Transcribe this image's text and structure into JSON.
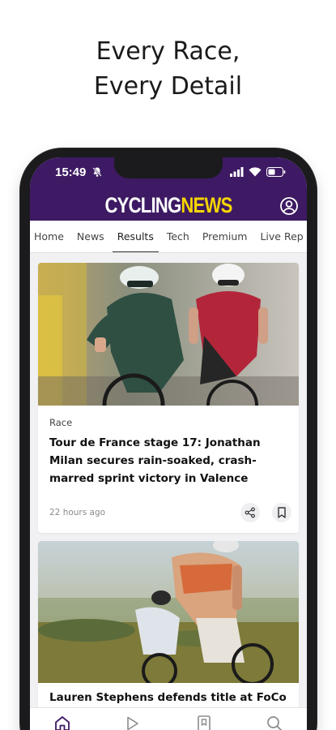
{
  "promo": {
    "line1": "Every Race,",
    "line2": "Every Detail"
  },
  "status_bar": {
    "time": "15:49"
  },
  "app": {
    "logo_part1": "CYCLING",
    "logo_part2": "NEWS"
  },
  "tabs": [
    {
      "label": "Home"
    },
    {
      "label": "News"
    },
    {
      "label": "Results",
      "active": true
    },
    {
      "label": "Tech"
    },
    {
      "label": "Premium"
    },
    {
      "label": "Live Rep"
    }
  ],
  "articles": [
    {
      "category": "Race",
      "title": "Tour de France stage 17: Jonathan Milan secures rain-soaked, crash-marred sprint victory in Valence",
      "time_ago": "22 hours ago"
    },
    {
      "title": "Lauren Stephens defends title at FoCo Fondo"
    }
  ],
  "bottom_nav": [
    "home-icon",
    "play-icon",
    "bookmark-icon",
    "search-icon"
  ],
  "colors": {
    "brand_purple": "#3d1a63",
    "brand_yellow": "#f5d400"
  }
}
